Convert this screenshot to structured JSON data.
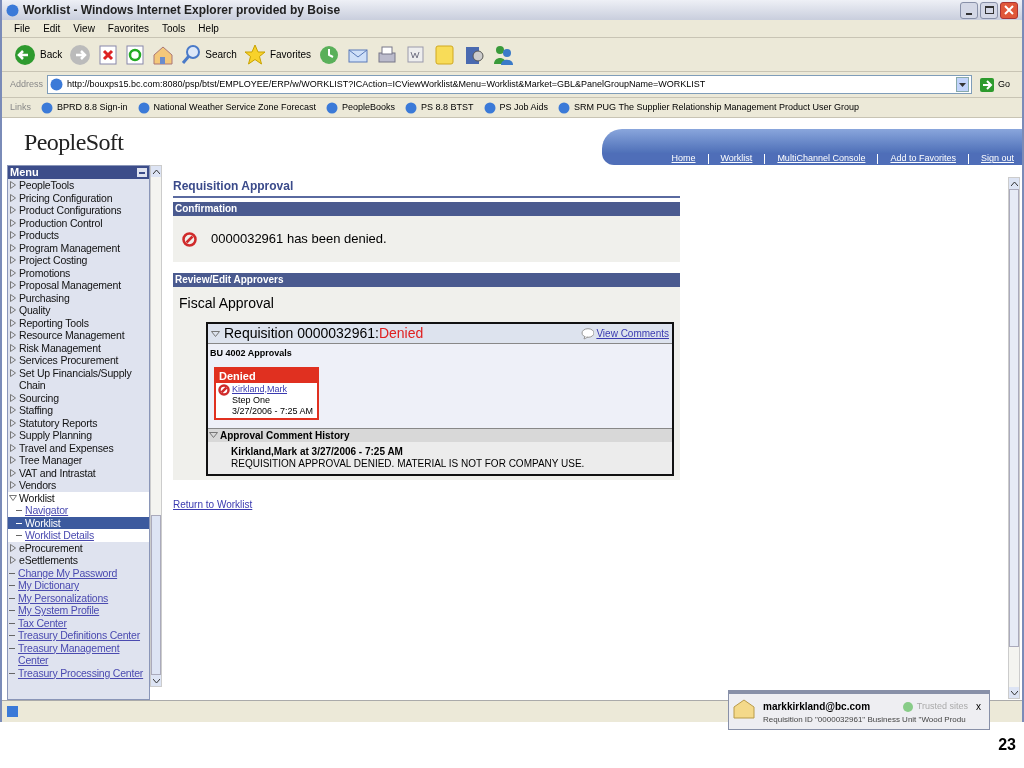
{
  "window": {
    "title": "Worklist - Windows Internet Explorer provided by Boise"
  },
  "menu_bar": [
    "File",
    "Edit",
    "View",
    "Favorites",
    "Tools",
    "Help"
  ],
  "toolbar": [
    {
      "kind": "back",
      "label": "Back"
    },
    {
      "kind": "forward"
    },
    {
      "kind": "stop"
    },
    {
      "kind": "refresh"
    },
    {
      "kind": "home"
    },
    {
      "kind": "search",
      "label": "Search"
    },
    {
      "kind": "favorites",
      "label": "Favorites"
    },
    {
      "kind": "history"
    },
    {
      "kind": "mail"
    },
    {
      "kind": "print"
    },
    {
      "kind": "word"
    },
    {
      "kind": "note"
    },
    {
      "kind": "research"
    },
    {
      "kind": "messenger"
    }
  ],
  "address_bar": {
    "label": "Address",
    "url": "http://bouxps15.bc.com:8080/psp/btst/EMPLOYEE/ERP/w/WORKLIST?ICAction=ICViewWorklist&Menu=Worklist&Market=GBL&PanelGroupName=WORKLIST",
    "go": "Go"
  },
  "links_bar": {
    "label": "Links",
    "items": [
      "BPRD 8.8 Sign-in",
      "National Weather Service Zone Forecast",
      "PeopleBooks",
      "PS 8.8 BTST",
      "PS Job Aids",
      "SRM PUG The Supplier Relationship Management Product User Group"
    ]
  },
  "header": {
    "logo": "PeopleSoft",
    "nav": [
      "Home",
      "Worklist",
      "MultiChannel Console",
      "Add to Favorites",
      "Sign out"
    ]
  },
  "sidebar": {
    "title": "Menu",
    "items": [
      {
        "kind": "folder",
        "label": "PeopleTools",
        "expanded": false
      },
      {
        "kind": "folder",
        "label": "Pricing Configuration",
        "expanded": false
      },
      {
        "kind": "folder",
        "label": "Product Configurations",
        "expanded": false
      },
      {
        "kind": "folder",
        "label": "Production Control",
        "expanded": false
      },
      {
        "kind": "folder",
        "label": "Products",
        "expanded": false
      },
      {
        "kind": "folder",
        "label": "Program Management",
        "expanded": false
      },
      {
        "kind": "folder",
        "label": "Project Costing",
        "expanded": false
      },
      {
        "kind": "folder",
        "label": "Promotions",
        "expanded": false
      },
      {
        "kind": "folder",
        "label": "Proposal Management",
        "expanded": false
      },
      {
        "kind": "folder",
        "label": "Purchasing",
        "expanded": false
      },
      {
        "kind": "folder",
        "label": "Quality",
        "expanded": false
      },
      {
        "kind": "folder",
        "label": "Reporting Tools",
        "expanded": false
      },
      {
        "kind": "folder",
        "label": "Resource Management",
        "expanded": false
      },
      {
        "kind": "folder",
        "label": "Risk Management",
        "expanded": false
      },
      {
        "kind": "folder",
        "label": "Services Procurement",
        "expanded": false
      },
      {
        "kind": "folder",
        "label": "Set Up Financials/Supply Chain",
        "expanded": false
      },
      {
        "kind": "folder",
        "label": "Sourcing",
        "expanded": false
      },
      {
        "kind": "folder",
        "label": "Staffing",
        "expanded": false
      },
      {
        "kind": "folder",
        "label": "Statutory Reports",
        "expanded": false
      },
      {
        "kind": "folder",
        "label": "Supply Planning",
        "expanded": false
      },
      {
        "kind": "folder",
        "label": "Travel and Expenses",
        "expanded": false
      },
      {
        "kind": "folder",
        "label": "Tree Manager",
        "expanded": false
      },
      {
        "kind": "folder",
        "label": "VAT and Intrastat",
        "expanded": false
      },
      {
        "kind": "folder",
        "label": "Vendors",
        "expanded": false
      },
      {
        "kind": "folder",
        "label": "Worklist",
        "expanded": true,
        "children": [
          {
            "kind": "link",
            "label": "Navigator",
            "selected": false
          },
          {
            "kind": "link",
            "label": "Worklist",
            "selected": true
          },
          {
            "kind": "link",
            "label": "Worklist Details",
            "selected": false
          }
        ]
      },
      {
        "kind": "folder",
        "label": "eProcurement",
        "expanded": false
      },
      {
        "kind": "folder",
        "label": "eSettlements",
        "expanded": false
      },
      {
        "kind": "link",
        "label": "Change My Password",
        "selected": false
      },
      {
        "kind": "link",
        "label": "My Dictionary",
        "selected": false
      },
      {
        "kind": "link",
        "label": "My Personalizations",
        "selected": false
      },
      {
        "kind": "link",
        "label": "My System Profile",
        "selected": false
      },
      {
        "kind": "link",
        "label": "Tax Center",
        "selected": false
      },
      {
        "kind": "link",
        "label": "Treasury Definitions Center",
        "selected": false
      },
      {
        "kind": "link",
        "label": "Treasury Management Center",
        "selected": false
      },
      {
        "kind": "link",
        "label": "Treasury Processing Center",
        "selected": false
      }
    ]
  },
  "page": {
    "title": "Requisition Approval",
    "confirmation": {
      "heading": "Confirmation",
      "message": "0000032961 has been denied."
    },
    "approvers": {
      "heading": "Review/Edit Approvers",
      "subtitle": "Fiscal Approval",
      "requisition": {
        "title": "Requisition 0000032961:",
        "status": "Denied",
        "view_comments": "View Comments",
        "group": "BU 4002 Approvals",
        "step": {
          "status": "Denied",
          "approver": "Kirkland,Mark",
          "step": "Step One",
          "time": "3/27/2006 - 7:25 AM"
        },
        "history": {
          "heading": "Approval Comment History",
          "author": "Kirkland,Mark at 3/27/2006 - 7:25 AM",
          "comment": "REQUISITION APPROVAL DENIED. MATERIAL IS NOT FOR COMPANY USE."
        }
      }
    },
    "return_link": "Return to Worklist"
  },
  "notification": {
    "sender": "markkirkland@bc.com",
    "zone": "Trusted sites",
    "close": "x",
    "preview": "Requisition ID \"0000032961\" Business Unit \"Wood Produ"
  },
  "slide_number": "23"
}
